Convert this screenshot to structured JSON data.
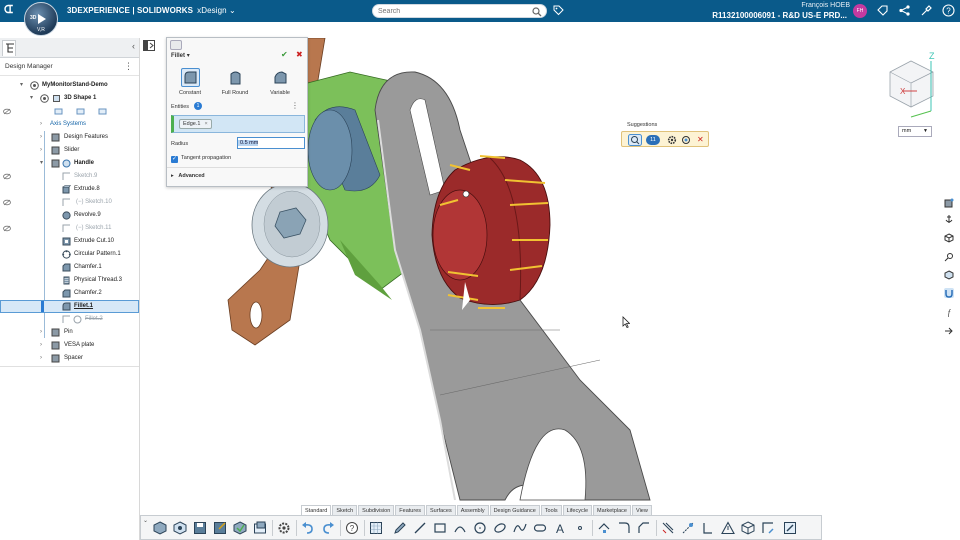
{
  "topbar": {
    "brand_bold": "3DEXPERIENCE | SOLIDWORKS",
    "app_name": "xDesign",
    "search_placeholder": "Search",
    "user_name": "François HOEB",
    "environment": "R1132100006091 - R&D US-E PRD...",
    "avatar_initials": "FH",
    "compass_letters": "3D",
    "compass_version": "V,R"
  },
  "design_manager": {
    "title": "Design Manager",
    "tree": [
      {
        "label": "MyMonitorStand-Demo",
        "style": "bold"
      },
      {
        "label": "3D Shape 1",
        "style": "bold"
      },
      {
        "label": "Axis Systems",
        "style": "blue"
      },
      {
        "label": "Design Features",
        "style": "normal"
      },
      {
        "label": "Slider",
        "style": "normal"
      },
      {
        "label": "Handle",
        "style": "bold"
      },
      {
        "label": "Sketch.9",
        "style": "gray"
      },
      {
        "label": "Extrude.8",
        "style": "normal"
      },
      {
        "label": "Sketch.10",
        "style": "gray"
      },
      {
        "label": "Revolve.9",
        "style": "normal"
      },
      {
        "label": "Sketch.11",
        "style": "gray"
      },
      {
        "label": "Extrude Cut.10",
        "style": "normal"
      },
      {
        "label": "Circular Pattern.1",
        "style": "normal"
      },
      {
        "label": "Chamfer.1",
        "style": "normal"
      },
      {
        "label": "Physical Thread.3",
        "style": "normal"
      },
      {
        "label": "Chamfer.2",
        "style": "normal"
      },
      {
        "label": "Fillet.1",
        "style": "selected"
      },
      {
        "label": "Fillet.2",
        "style": "strike"
      },
      {
        "label": "Pin",
        "style": "normal"
      },
      {
        "label": "VESA plate",
        "style": "normal"
      },
      {
        "label": "Spacer",
        "style": "normal"
      }
    ]
  },
  "fillet": {
    "title": "Fillet",
    "types": [
      "Constant",
      "Full Round",
      "Variable"
    ],
    "entities_label": "Entities",
    "entities_count": "1",
    "entity_chip": "Edge.1",
    "radius_label": "Radius",
    "radius_value": "0.5 mm",
    "tangent_label": "Tangent propagation",
    "advanced_label": "Advanced"
  },
  "suggestions": {
    "title": "Suggestions",
    "badge": "11"
  },
  "viewcube": {
    "axis_z": "Z",
    "axis_x": "X",
    "unit": "mm"
  },
  "bottom_tabs": [
    "Standard",
    "Sketch",
    "Subdivision",
    "Features",
    "Surfaces",
    "Assembly",
    "Design Guidance",
    "Tools",
    "Lifecycle",
    "Marketplace",
    "View"
  ],
  "colors": {
    "topbar": "#0a5a8a",
    "handle_red": "#9b2a2a",
    "bracket_gray": "#9a9a9a",
    "bracket_brown": "#b8774e",
    "slider_green": "#7cc05a",
    "accent_blue": "#2a7bd3"
  }
}
